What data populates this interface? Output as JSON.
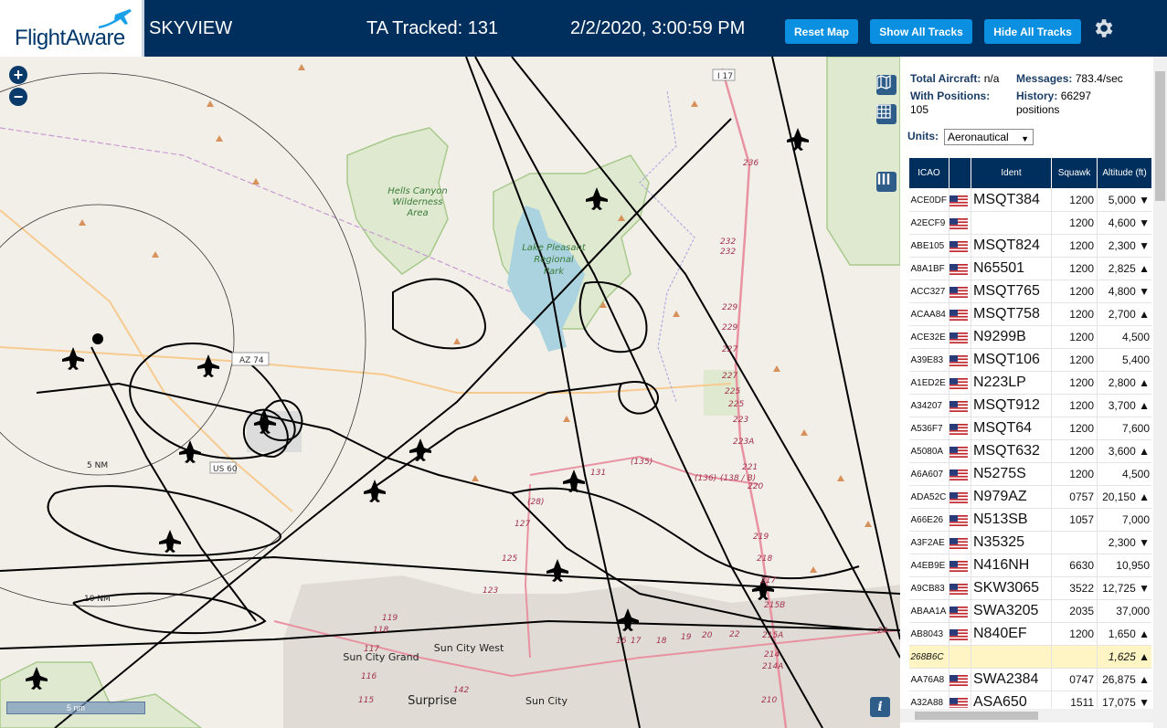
{
  "header": {
    "logo_text": "FlightAware",
    "app_title": "SKYVIEW",
    "tracked": "TA Tracked: 131",
    "datetime": "2/2/2020, 3:00:59 PM",
    "buttons": {
      "reset": "Reset Map",
      "show_all": "Show All Tracks",
      "hide_all": "Hide All Tracks"
    }
  },
  "map": {
    "zoom_in": "+",
    "zoom_out": "−",
    "scale_label": "5 nm",
    "info": "i",
    "labels": {
      "hells_canyon": [
        "Hells Canyon",
        "Wilderness",
        "Area"
      ],
      "lake_pleasant": [
        "Lake Pleasant",
        "Regional",
        "Park"
      ],
      "az74": "AZ 74",
      "us60": "US 60",
      "i17": "I 17",
      "ring5": "5 NM",
      "ring10": "10 NM",
      "sun_city_grand": "Sun City Grand",
      "sun_city_west": "Sun City West",
      "sun_city": "Sun City",
      "surprise": "Surprise",
      "r135": "(135)",
      "r136": "(136)",
      "r138": "(138 / B)",
      "r131": "131",
      "r128": "(28)",
      "r127": "127",
      "r125": "125",
      "r123": "123",
      "r119": "119",
      "r118": "118",
      "r117": "117",
      "r116": "116",
      "r115": "115",
      "r142": "142",
      "r236": "236",
      "r232": "232",
      "r229": "229",
      "r227": "227",
      "r225": "225",
      "r223": "223",
      "r223a": "223A",
      "r221": "221",
      "r220": "220",
      "r219": "219",
      "r218": "218",
      "r217": "217",
      "r215b": "215B",
      "r215a": "215A",
      "r214": "214",
      "r214a": "214A",
      "r210": "210",
      "r16": "16",
      "r17": "17",
      "r18": "18",
      "r19": "19",
      "r20": "20",
      "r22": "22",
      "r24": "24"
    },
    "colors": {
      "water": "#aad3df",
      "park": "#c9dfb6",
      "track": "#000000",
      "highway": "#e892a2",
      "major_road": "#f7ca8f"
    }
  },
  "stats": {
    "total_label": "Total Aircraft:",
    "total_value": "n/a",
    "messages_label": "Messages:",
    "messages_value": "783.4/sec",
    "positions_label": "With Positions:",
    "positions_value": "105",
    "history_label": "History:",
    "history_value": "66297",
    "history_unit": "positions",
    "units_label": "Units:",
    "units_value": "Aeronautical"
  },
  "table": {
    "headers": {
      "icao": "ICAO",
      "ident": "Ident",
      "squawk": "Squawk",
      "altitude": "Altitude (ft)"
    },
    "rows": [
      {
        "icao": "ACE0DF",
        "flag": true,
        "ident": "MSQT384",
        "squawk": "1200",
        "alt": "5,000 ▼"
      },
      {
        "icao": "A2ECF9",
        "flag": true,
        "ident": "",
        "squawk": "1200",
        "alt": "4,600 ▼"
      },
      {
        "icao": "ABE105",
        "flag": true,
        "ident": "MSQT824",
        "squawk": "1200",
        "alt": "2,300 ▼"
      },
      {
        "icao": "A8A1BF",
        "flag": true,
        "ident": "N65501",
        "squawk": "1200",
        "alt": "2,825 ▲"
      },
      {
        "icao": "ACC327",
        "flag": true,
        "ident": "MSQT765",
        "squawk": "1200",
        "alt": "4,800 ▼"
      },
      {
        "icao": "ACAA84",
        "flag": true,
        "ident": "MSQT758",
        "squawk": "1200",
        "alt": "2,700 ▲"
      },
      {
        "icao": "ACE32E",
        "flag": true,
        "ident": "N9299B",
        "squawk": "1200",
        "alt": "4,500"
      },
      {
        "icao": "A39E83",
        "flag": true,
        "ident": "MSQT106",
        "squawk": "1200",
        "alt": "5,400"
      },
      {
        "icao": "A1ED2E",
        "flag": true,
        "ident": "N223LP",
        "squawk": "1200",
        "alt": "2,800 ▲"
      },
      {
        "icao": "A34207",
        "flag": true,
        "ident": "MSQT912",
        "squawk": "1200",
        "alt": "3,700 ▲"
      },
      {
        "icao": "A536F7",
        "flag": true,
        "ident": "MSQT64",
        "squawk": "1200",
        "alt": "7,600"
      },
      {
        "icao": "A5080A",
        "flag": true,
        "ident": "MSQT632",
        "squawk": "1200",
        "alt": "3,600 ▲"
      },
      {
        "icao": "A6A607",
        "flag": true,
        "ident": "N5275S",
        "squawk": "1200",
        "alt": "4,500"
      },
      {
        "icao": "ADA52C",
        "flag": true,
        "ident": "N979AZ",
        "squawk": "0757",
        "alt": "20,150 ▲"
      },
      {
        "icao": "A66E26",
        "flag": true,
        "ident": "N513SB",
        "squawk": "1057",
        "alt": "7,000"
      },
      {
        "icao": "A3F2AE",
        "flag": true,
        "ident": "N35325",
        "squawk": "",
        "alt": "2,300 ▼"
      },
      {
        "icao": "A4EB9E",
        "flag": true,
        "ident": "N416NH",
        "squawk": "6630",
        "alt": "10,950"
      },
      {
        "icao": "A9CB83",
        "flag": true,
        "ident": "SKW3065",
        "squawk": "3522",
        "alt": "12,725 ▼"
      },
      {
        "icao": "ABAA1A",
        "flag": true,
        "ident": "SWA3205",
        "squawk": "2035",
        "alt": "37,000"
      },
      {
        "icao": "AB8043",
        "flag": true,
        "ident": "N840EF",
        "squawk": "1200",
        "alt": "1,650 ▲"
      },
      {
        "icao": "268B6C",
        "flag": false,
        "ident": "",
        "squawk": "",
        "alt": "1,625 ▲",
        "highlight": true
      },
      {
        "icao": "AA76A8",
        "flag": true,
        "ident": "SWA2384",
        "squawk": "0747",
        "alt": "26,875 ▲"
      },
      {
        "icao": "A32A88",
        "flag": true,
        "ident": "ASA650",
        "squawk": "1511",
        "alt": "17,075 ▼"
      }
    ]
  }
}
